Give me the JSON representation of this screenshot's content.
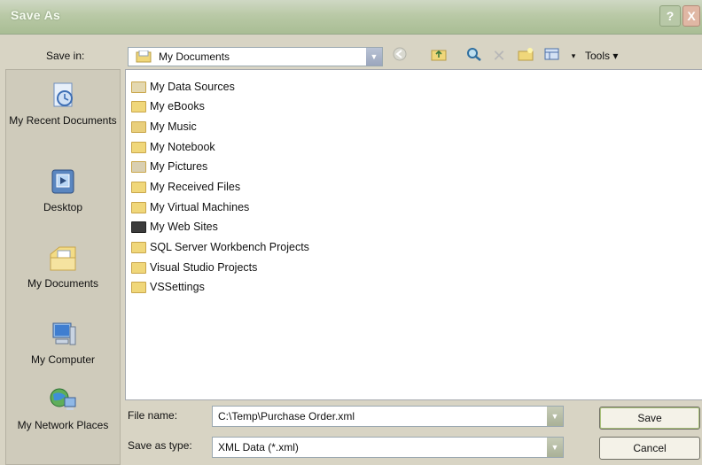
{
  "window": {
    "title": "Save As"
  },
  "title_buttons": {
    "help": "?",
    "close": "X"
  },
  "toolbar": {
    "save_in_label": "Save in:",
    "save_in_value": "My Documents",
    "tools_label": "Tools"
  },
  "places": [
    {
      "label": "My Recent Documents",
      "icon": "recent-documents-icon"
    },
    {
      "label": "Desktop",
      "icon": "desktop-icon"
    },
    {
      "label": "My Documents",
      "icon": "my-documents-icon"
    },
    {
      "label": "My Computer",
      "icon": "my-computer-icon"
    },
    {
      "label": "My Network Places",
      "icon": "network-places-icon"
    }
  ],
  "files": [
    {
      "name": "My Data Sources",
      "icon": "data-folder-icon"
    },
    {
      "name": "My eBooks",
      "icon": "folder-icon"
    },
    {
      "name": "My Music",
      "icon": "music-folder-icon"
    },
    {
      "name": "My Notebook",
      "icon": "folder-icon"
    },
    {
      "name": "My Pictures",
      "icon": "pictures-folder-icon"
    },
    {
      "name": "My Received Files",
      "icon": "folder-icon"
    },
    {
      "name": "My Virtual Machines",
      "icon": "folder-icon"
    },
    {
      "name": "My Web Sites",
      "icon": "web-folder-icon"
    },
    {
      "name": "SQL Server Workbench Projects",
      "icon": "folder-icon"
    },
    {
      "name": "Visual Studio Projects",
      "icon": "folder-icon"
    },
    {
      "name": "VSSettings",
      "icon": "folder-icon"
    }
  ],
  "bottom": {
    "file_name_label": "File name:",
    "file_name_value": "C:\\Temp\\Purchase Order.xml",
    "save_as_type_label": "Save as type:",
    "save_as_type_value": "XML Data (*.xml)",
    "save_button": "Save",
    "cancel_button": "Cancel"
  }
}
